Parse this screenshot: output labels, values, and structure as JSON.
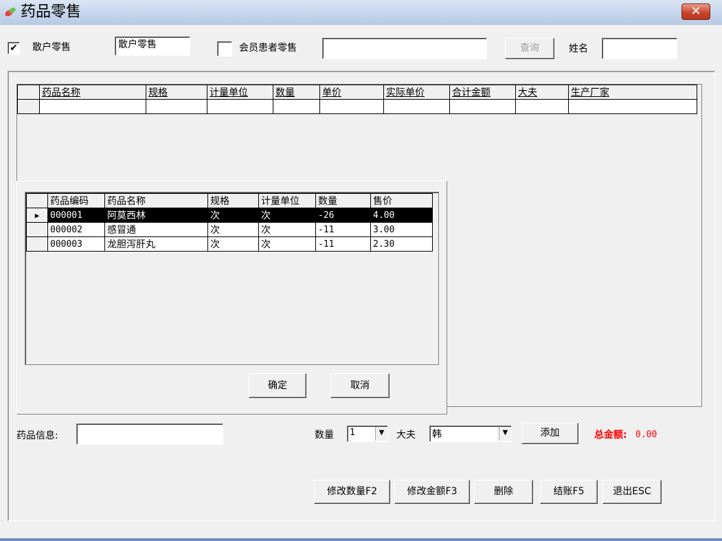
{
  "window": {
    "title": "药品零售",
    "close_glyph": "✕"
  },
  "top": {
    "retail_checkbox": {
      "checked": true,
      "mark": "✔",
      "label": "散户零售"
    },
    "retail_field_value": "散户零售",
    "member_checkbox": {
      "checked": false,
      "label": "会员患者零售"
    },
    "member_field_value": "",
    "query_button": "查询",
    "name_label": "姓名",
    "name_value": ""
  },
  "cart_grid": {
    "columns": [
      "药品名称",
      "规格",
      "计量单位",
      "数量",
      "单价",
      "实际单价",
      "合计金额",
      "大夫",
      "生产厂家"
    ],
    "rows": []
  },
  "picker": {
    "columns": [
      "药品编码",
      "药品名称",
      "规格",
      "计量单位",
      "数量",
      "售价"
    ],
    "selected_marker": "▶",
    "rows": [
      [
        "000001",
        "阿莫西林",
        "次",
        "次",
        "-26",
        "4.00"
      ],
      [
        "000002",
        "感冒通",
        "次",
        "次",
        "-11",
        "3.00"
      ],
      [
        "000003",
        "龙胆泻肝丸",
        "次",
        "次",
        "-11",
        "2.30"
      ]
    ],
    "selected_row": 0,
    "confirm_button": "确定",
    "cancel_button": "取消"
  },
  "bottom": {
    "drug_info_label": "药品信息:",
    "drug_info_value": "",
    "qty_label": "数量",
    "qty_value": "1",
    "doctor_label": "大夫",
    "doctor_value": "韩",
    "add_button": "添加",
    "total_label": "总金额:",
    "total_value": "0.00",
    "total_color": "#ff0000",
    "dropdown_glyph": "▼"
  },
  "actions": {
    "edit_qty": "修改数量F2",
    "edit_amount": "修改金额F3",
    "delete": "删除",
    "checkout": "结账F5",
    "exit": "退出ESC"
  },
  "icons": {
    "app": "pill-icon",
    "close": "close-icon",
    "dropdown": "chevron-down-icon",
    "row_pointer": "row-pointer-icon"
  }
}
